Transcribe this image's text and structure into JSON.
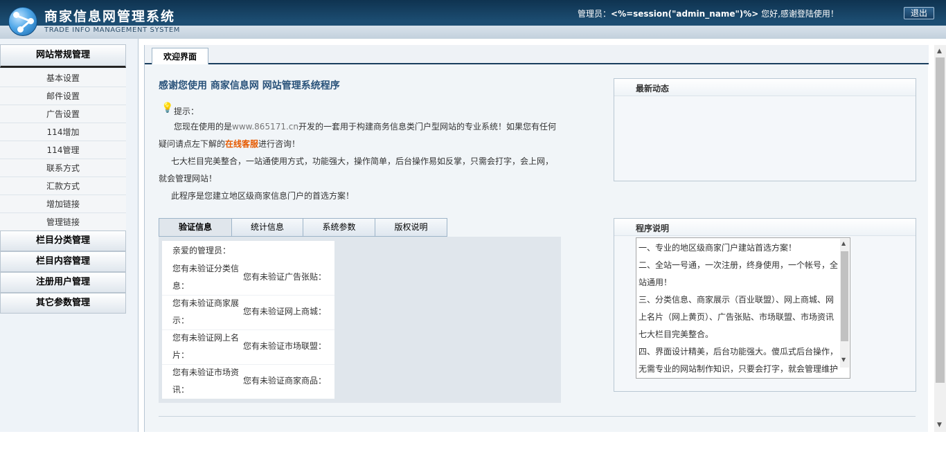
{
  "header": {
    "title": "商家信息网管理系统",
    "subtitle": "TRADE INFO MANAGEMENT SYSTEM",
    "admin_label": "管理员：",
    "admin_name": "<%=session(\"admin_name\")%>",
    "admin_greeting": " 您好,感谢登陆使用！",
    "logout_label": "退出"
  },
  "sidebar": {
    "groups": [
      {
        "label": "网站常规管理"
      },
      {
        "label": "栏目分类管理"
      },
      {
        "label": "栏目内容管理"
      },
      {
        "label": "注册用户管理"
      },
      {
        "label": "其它参数管理"
      }
    ],
    "items": [
      {
        "label": "基本设置"
      },
      {
        "label": "邮件设置"
      },
      {
        "label": "广告设置"
      },
      {
        "label": "114增加"
      },
      {
        "label": "114管理"
      },
      {
        "label": "联系方式"
      },
      {
        "label": "汇款方式"
      },
      {
        "label": "增加链接"
      },
      {
        "label": "管理链接"
      }
    ]
  },
  "main": {
    "tab_label": "欢迎界面",
    "intro_title": "感谢您使用 商家信息网 网站管理系统程序",
    "tip_label": "提示：",
    "para1_a": "您现在使用的是",
    "para1_url": "www.865171.cn",
    "para1_b": "开发的一套用于构建商务信息类门户型网站的专业系统！如果您有任何疑问请点左下解的",
    "para1_link": "在线客服",
    "para1_c": "进行咨询！",
    "para2": "七大栏目完美整合，一站通使用方式，功能强大，操作简单，后台操作易如反掌，只需会打字，会上网，就会管理网站！",
    "para3": "此程序是您建立地区级商家信息门户的首选方案！",
    "tabs": [
      {
        "label": "验证信息"
      },
      {
        "label": "统计信息"
      },
      {
        "label": "系统参数"
      },
      {
        "label": "版权说明"
      }
    ],
    "verify": {
      "head": "亲爱的管理员：",
      "rows": [
        {
          "left": "您有未验证分类信息：",
          "right": "您有未验证广告张贴："
        },
        {
          "left": "您有未验证商家展示：",
          "right": "您有未验证网上商城："
        },
        {
          "left": "您有未验证网上名片：",
          "right": "您有未验证市场联盟："
        },
        {
          "left": "您有未验证市场资讯：",
          "right": "您有未验证商家商品："
        }
      ]
    },
    "news_title": "最新动态",
    "desc_title": "程序说明",
    "desc_lines": [
      "一、专业的地区级商家门户建站首选方案！",
      "二、全站一号通，一次注册，终身使用，一个帐号，全站通用！",
      "三、分类信息、商家展示（百业联盟）、网上商城、网上名片（网上黄页）、广告张贴、市场联盟、市场资讯七大栏目完美整合。",
      "四、界面设计精美，后台功能强大。傻瓜式后台操作，无需专业的网站制作知识，只要会打字，就会管理维护"
    ]
  },
  "colors": {
    "header_dark": "#0f3350",
    "accent_title": "#29527a",
    "link_hot": "#e65a00"
  }
}
